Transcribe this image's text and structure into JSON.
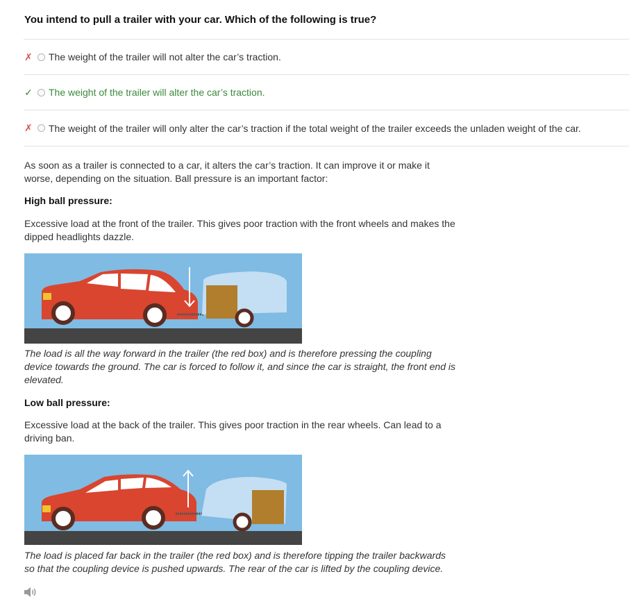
{
  "question": "You intend to pull a trailer with your car. Which of the following is true?",
  "options": [
    {
      "text": "The weight of the trailer will not alter the car’s traction.",
      "status": "incorrect",
      "mark": "✗"
    },
    {
      "text": "The weight of the trailer will alter the car’s traction.",
      "status": "correct",
      "mark": "✓"
    },
    {
      "text": "The weight of the trailer will only alter the car’s traction if the total weight of the trailer exceeds the unladen weight of the car.",
      "status": "incorrect",
      "mark": "✗"
    }
  ],
  "explanation": {
    "intro": "As soon as a trailer is connected to a car, it alters the car’s traction. It can improve it or make it worse, depending on the situation. Ball pressure is an important factor:",
    "high": {
      "heading": "High ball pressure:",
      "text": "Excessive load at the front of the trailer. This gives poor traction with the front wheels and makes the dipped headlights dazzle.",
      "caption": "The load is all the way forward in the trailer (the red box) and is therefore pressing the coupling device towards the ground. The car is forced to follow it, and since the car is straight, the front end is elevated."
    },
    "low": {
      "heading": "Low ball pressure:",
      "text": "Excessive load at the back of the trailer. This gives poor traction in the rear wheels. Can lead to a driving ban.",
      "caption": "The load is placed far back in the trailer (the red box) and is therefore tipping the trailer backwards so that the coupling device is pushed upwards. The rear of the car is lifted by the coupling device."
    }
  },
  "colors": {
    "sky": "#7fbbe3",
    "road": "#444444",
    "car": "#d9452f",
    "trailer": "#c4def3",
    "load": "#b07e2c",
    "correct": "#3a8a3a",
    "incorrect": "#d9534f"
  },
  "icons": {
    "audio": "speaker-icon"
  }
}
